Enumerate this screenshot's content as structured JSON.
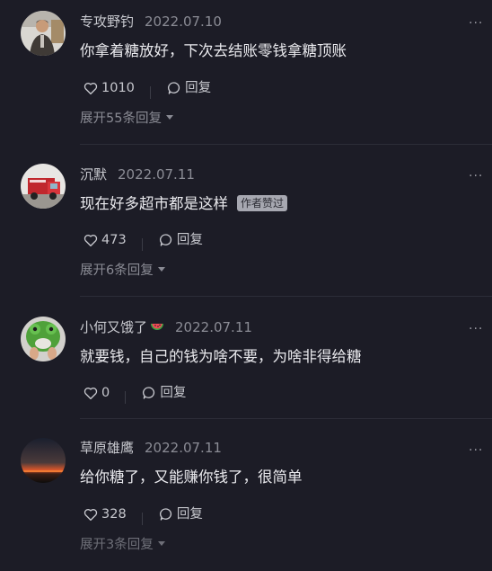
{
  "comments": [
    {
      "username": "专攻野钓",
      "date": "2022.07.10",
      "content": "你拿着糖放好，下次去结账零钱拿糖顶账",
      "likes": "1010",
      "reply_label": "回复",
      "expand_label": "展开55条回复",
      "avatar_icon": "man-portrait-avatar"
    },
    {
      "username": "沉默",
      "date": "2022.07.11",
      "content": "现在好多超市都是这样",
      "author_badge": "作者赞过",
      "likes": "473",
      "reply_label": "回复",
      "expand_label": "展开6条回复",
      "avatar_icon": "red-truck-avatar"
    },
    {
      "username": "小何又饿了",
      "date": "2022.07.11",
      "content": "就要钱，自己的钱为啥不要，为啥非得给糖",
      "likes": "0",
      "reply_label": "回复",
      "avatar_icon": "green-frog-mask-avatar",
      "name_emoji": "watermelon-emoji"
    },
    {
      "username": "草原雄鹰",
      "date": "2022.07.11",
      "content": "给你糖了，又能赚你钱了，很简单",
      "likes": "328",
      "reply_label": "回复",
      "expand_label": "展开3条回复",
      "avatar_icon": "sunset-landscape-avatar"
    }
  ],
  "more_label": "···",
  "colors": {
    "background": "#1c1c26",
    "username": "#c8c9cf",
    "content": "#eaeaee",
    "secondary": "#8a8b94",
    "badge_bg": "#a7a8b1"
  }
}
